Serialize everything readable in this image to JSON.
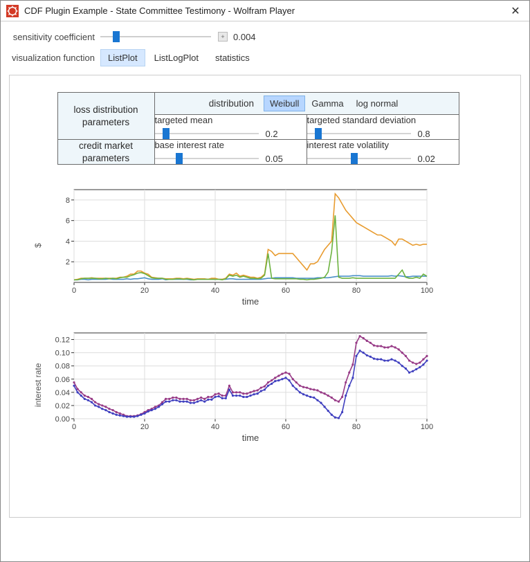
{
  "window": {
    "title": "CDF Plugin Example - State Committee Testimony - Wolfram Player"
  },
  "controls": {
    "sensitivity": {
      "label": "sensitivity coefficient",
      "value": "0.004",
      "position_pct": 12
    },
    "vizfunc": {
      "label": "visualization function",
      "options": [
        "ListPlot",
        "ListLogPlot",
        "statistics"
      ],
      "selected": 0
    }
  },
  "params": {
    "loss_header": "loss distribution\nparameters",
    "credit_header": "credit market\nparameters",
    "distribution": {
      "label": "distribution",
      "options": [
        "Weibull",
        "Gamma",
        "log normal"
      ],
      "selected": 0
    },
    "targeted_mean": {
      "label": "targeted mean",
      "value": "0.2",
      "position_pct": 8
    },
    "targeted_sd": {
      "label": "targeted standard deviation",
      "value": "0.8",
      "position_pct": 8
    },
    "base_rate": {
      "label": "base interest rate",
      "value": "0.05",
      "position_pct": 22
    },
    "rate_vol": {
      "label": "interest rate volatility",
      "value": "0.02",
      "position_pct": 45
    }
  },
  "chart_data": [
    {
      "type": "line",
      "title": "",
      "xlabel": "time",
      "ylabel": "$",
      "xlim": [
        0,
        100
      ],
      "ylim": [
        0,
        9
      ],
      "xticks": [
        0,
        20,
        40,
        60,
        80,
        100
      ],
      "yticks": [
        2,
        4,
        6,
        8
      ],
      "series": [
        {
          "name": "blue",
          "color": "#4a90c7",
          "values": [
            0.25,
            0.25,
            0.3,
            0.3,
            0.25,
            0.3,
            0.3,
            0.3,
            0.3,
            0.3,
            0.35,
            0.3,
            0.3,
            0.3,
            0.3,
            0.35,
            0.3,
            0.35,
            0.35,
            0.4,
            0.45,
            0.35,
            0.3,
            0.3,
            0.3,
            0.35,
            0.25,
            0.3,
            0.3,
            0.3,
            0.3,
            0.3,
            0.3,
            0.25,
            0.25,
            0.3,
            0.3,
            0.3,
            0.3,
            0.3,
            0.3,
            0.3,
            0.3,
            0.3,
            0.35,
            0.35,
            0.3,
            0.3,
            0.3,
            0.3,
            0.3,
            0.3,
            0.3,
            0.3,
            0.35,
            0.4,
            0.4,
            0.45,
            0.45,
            0.45,
            0.45,
            0.45,
            0.45,
            0.4,
            0.4,
            0.4,
            0.4,
            0.4,
            0.4,
            0.45,
            0.45,
            0.45,
            0.45,
            0.5,
            0.55,
            0.6,
            0.6,
            0.6,
            0.6,
            0.65,
            0.65,
            0.65,
            0.6,
            0.6,
            0.6,
            0.6,
            0.6,
            0.6,
            0.6,
            0.6,
            0.65,
            0.6,
            0.65,
            0.6,
            0.55,
            0.55,
            0.6,
            0.6,
            0.6,
            0.6,
            0.6
          ]
        },
        {
          "name": "orange",
          "color": "#e89b2e",
          "values": [
            0.25,
            0.3,
            0.4,
            0.4,
            0.4,
            0.45,
            0.4,
            0.4,
            0.4,
            0.4,
            0.4,
            0.4,
            0.4,
            0.5,
            0.5,
            0.6,
            0.8,
            0.8,
            1.1,
            1.1,
            0.9,
            0.8,
            0.5,
            0.45,
            0.4,
            0.4,
            0.35,
            0.35,
            0.35,
            0.4,
            0.4,
            0.35,
            0.4,
            0.35,
            0.3,
            0.35,
            0.35,
            0.35,
            0.3,
            0.4,
            0.4,
            0.3,
            0.3,
            0.4,
            0.8,
            0.7,
            0.9,
            0.6,
            0.7,
            0.6,
            0.5,
            0.5,
            0.4,
            0.5,
            0.8,
            3.2,
            3.0,
            2.6,
            2.8,
            2.8,
            2.8,
            2.8,
            2.8,
            2.4,
            2.0,
            1.6,
            1.2,
            1.8,
            1.8,
            2.0,
            2.6,
            3.2,
            3.6,
            4.0,
            8.6,
            8.2,
            7.6,
            7.0,
            6.6,
            6.2,
            5.8,
            5.6,
            5.4,
            5.2,
            5.0,
            4.8,
            4.6,
            4.6,
            4.4,
            4.2,
            4.0,
            3.6,
            4.2,
            4.2,
            4.0,
            3.8,
            3.6,
            3.7,
            3.6,
            3.7,
            3.7
          ]
        },
        {
          "name": "green",
          "color": "#6cb23f",
          "values": [
            0.25,
            0.25,
            0.35,
            0.4,
            0.4,
            0.4,
            0.4,
            0.35,
            0.35,
            0.4,
            0.35,
            0.4,
            0.35,
            0.45,
            0.5,
            0.5,
            0.65,
            0.75,
            0.9,
            0.95,
            0.85,
            0.65,
            0.45,
            0.4,
            0.4,
            0.4,
            0.3,
            0.3,
            0.3,
            0.35,
            0.35,
            0.3,
            0.35,
            0.3,
            0.25,
            0.3,
            0.3,
            0.3,
            0.3,
            0.3,
            0.3,
            0.3,
            0.25,
            0.35,
            0.7,
            0.6,
            0.7,
            0.5,
            0.6,
            0.5,
            0.4,
            0.4,
            0.35,
            0.4,
            0.7,
            2.8,
            0.4,
            0.35,
            0.35,
            0.35,
            0.35,
            0.35,
            0.35,
            0.35,
            0.3,
            0.3,
            0.25,
            0.3,
            0.3,
            0.35,
            0.4,
            0.5,
            1.0,
            3.0,
            6.5,
            0.5,
            0.4,
            0.4,
            0.4,
            0.45,
            0.4,
            0.4,
            0.4,
            0.4,
            0.4,
            0.4,
            0.4,
            0.4,
            0.4,
            0.4,
            0.4,
            0.4,
            0.8,
            1.2,
            0.5,
            0.4,
            0.4,
            0.5,
            0.4,
            0.8,
            0.6
          ]
        }
      ]
    },
    {
      "type": "line",
      "title": "",
      "xlabel": "time",
      "ylabel": "interest rate",
      "xlim": [
        0,
        100
      ],
      "ylim": [
        0,
        0.13
      ],
      "xticks": [
        0,
        20,
        40,
        60,
        80,
        100
      ],
      "yticks": [
        0.0,
        0.02,
        0.04,
        0.06,
        0.08,
        0.1,
        0.12
      ],
      "series": [
        {
          "name": "purple",
          "color": "#973a86",
          "values": [
            0.055,
            0.045,
            0.04,
            0.035,
            0.033,
            0.03,
            0.025,
            0.022,
            0.02,
            0.018,
            0.015,
            0.013,
            0.01,
            0.008,
            0.006,
            0.004,
            0.004,
            0.004,
            0.005,
            0.007,
            0.01,
            0.013,
            0.015,
            0.018,
            0.02,
            0.025,
            0.03,
            0.03,
            0.032,
            0.032,
            0.03,
            0.03,
            0.03,
            0.028,
            0.028,
            0.03,
            0.032,
            0.03,
            0.033,
            0.033,
            0.037,
            0.038,
            0.035,
            0.035,
            0.05,
            0.04,
            0.04,
            0.04,
            0.038,
            0.038,
            0.04,
            0.042,
            0.043,
            0.047,
            0.049,
            0.055,
            0.058,
            0.062,
            0.065,
            0.068,
            0.07,
            0.068,
            0.06,
            0.055,
            0.05,
            0.048,
            0.047,
            0.045,
            0.044,
            0.043,
            0.04,
            0.038,
            0.035,
            0.032,
            0.028,
            0.026,
            0.033,
            0.055,
            0.07,
            0.082,
            0.115,
            0.125,
            0.122,
            0.118,
            0.115,
            0.111,
            0.11,
            0.11,
            0.108,
            0.108,
            0.11,
            0.108,
            0.105,
            0.1,
            0.095,
            0.088,
            0.085,
            0.083,
            0.085,
            0.09,
            0.095
          ]
        },
        {
          "name": "navy",
          "color": "#3f3fbf",
          "values": [
            0.05,
            0.04,
            0.035,
            0.03,
            0.028,
            0.025,
            0.02,
            0.018,
            0.015,
            0.013,
            0.01,
            0.008,
            0.006,
            0.005,
            0.004,
            0.003,
            0.003,
            0.003,
            0.004,
            0.006,
            0.008,
            0.011,
            0.013,
            0.015,
            0.018,
            0.022,
            0.026,
            0.026,
            0.028,
            0.028,
            0.026,
            0.026,
            0.026,
            0.024,
            0.024,
            0.026,
            0.028,
            0.026,
            0.029,
            0.029,
            0.033,
            0.034,
            0.031,
            0.031,
            0.044,
            0.035,
            0.035,
            0.035,
            0.033,
            0.033,
            0.035,
            0.037,
            0.038,
            0.042,
            0.044,
            0.05,
            0.053,
            0.057,
            0.058,
            0.06,
            0.062,
            0.058,
            0.05,
            0.045,
            0.04,
            0.037,
            0.035,
            0.033,
            0.032,
            0.028,
            0.024,
            0.018,
            0.012,
            0.006,
            0.002,
            0.001,
            0.01,
            0.035,
            0.05,
            0.062,
            0.095,
            0.103,
            0.1,
            0.096,
            0.094,
            0.091,
            0.09,
            0.09,
            0.088,
            0.088,
            0.09,
            0.088,
            0.085,
            0.08,
            0.076,
            0.07,
            0.072,
            0.075,
            0.078,
            0.082,
            0.088
          ]
        }
      ]
    }
  ]
}
